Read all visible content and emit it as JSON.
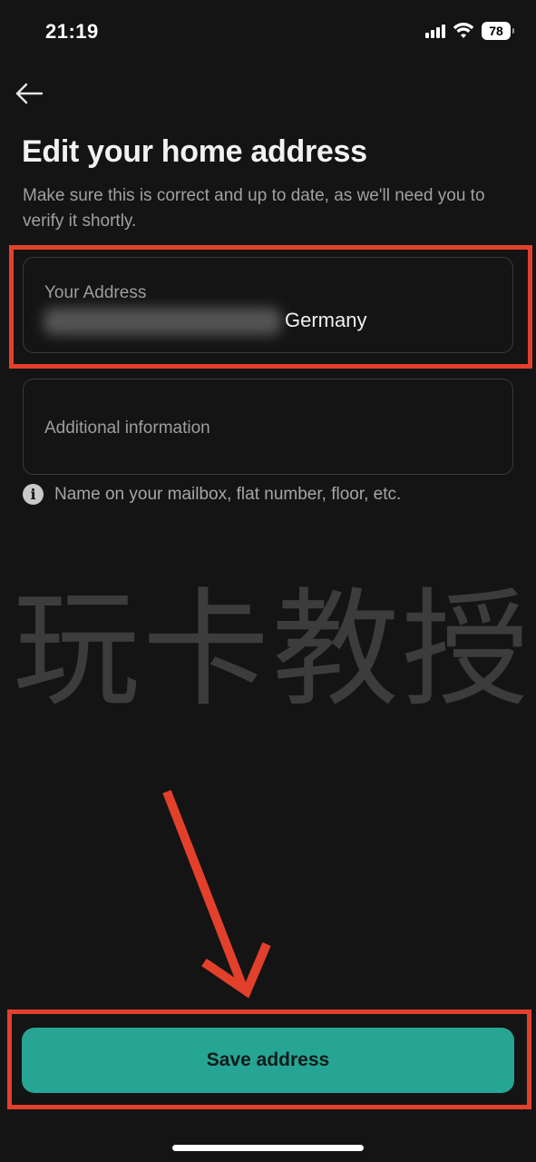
{
  "status_bar": {
    "time": "21:19",
    "battery": "78",
    "icons": [
      "signal-icon",
      "wifi-icon",
      "battery-icon"
    ]
  },
  "header": {
    "back_icon": "arrow-left-icon",
    "title": "Edit your home address",
    "subtitle": "Make sure this is correct and up to date, as we'll need you to verify it shortly."
  },
  "form": {
    "address": {
      "label": "Your Address",
      "value_visible": "Germany"
    },
    "additional": {
      "placeholder": "Additional information"
    },
    "hint": {
      "icon": "info-icon",
      "text": "Name on your mailbox, flat number, floor, etc."
    }
  },
  "watermark": "玩卡教授",
  "actions": {
    "save_label": "Save address"
  },
  "colors": {
    "background": "#141414",
    "accent": "#26a595",
    "annotation": "#e3402c"
  }
}
